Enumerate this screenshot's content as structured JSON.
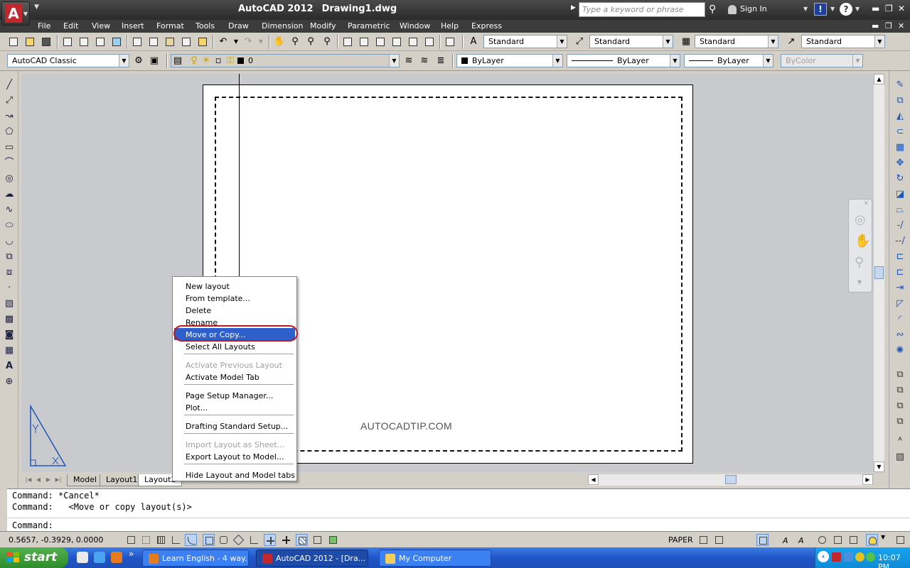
{
  "title": {
    "app": "AutoCAD 2012",
    "document": "Drawing1.dwg",
    "search_placeholder": "Type a keyword or phrase",
    "sign_in": "Sign In"
  },
  "menu": [
    "File",
    "Edit",
    "View",
    "Insert",
    "Format",
    "Tools",
    "Draw",
    "Dimension",
    "Modify",
    "Parametric",
    "Window",
    "Help",
    "Express"
  ],
  "styles": {
    "text_style": "Standard",
    "dim_style": "Standard",
    "table_style": "Standard",
    "multileader_style": "Standard"
  },
  "workspace": "AutoCAD Classic",
  "layer": "0",
  "properties": {
    "color": "ByLayer",
    "linetype": "ByLayer",
    "lineweight": "ByLayer",
    "plotstyle": "ByColor"
  },
  "watermark": "AUTOCADTIP.COM",
  "layout_tabs": [
    "Model",
    "Layout1",
    "Layout2"
  ],
  "context_menu": {
    "items": [
      {
        "label": "New layout",
        "disabled": false,
        "highlighted": false
      },
      {
        "label": "From template...",
        "disabled": false,
        "highlighted": false
      },
      {
        "label": "Delete",
        "disabled": false,
        "highlighted": false
      },
      {
        "label": "Rename",
        "disabled": false,
        "highlighted": false
      },
      {
        "label": "Move or Copy...",
        "disabled": false,
        "highlighted": true
      },
      {
        "label": "Select All Layouts",
        "disabled": false,
        "highlighted": false
      },
      {
        "label": "Activate Previous Layout",
        "disabled": true,
        "highlighted": false
      },
      {
        "label": "Activate Model Tab",
        "disabled": false,
        "highlighted": false
      },
      {
        "label": "Page Setup Manager...",
        "disabled": false,
        "highlighted": false
      },
      {
        "label": "Plot...",
        "disabled": false,
        "highlighted": false
      },
      {
        "label": "Drafting Standard Setup...",
        "disabled": false,
        "highlighted": false
      },
      {
        "label": "Import Layout as Sheet...",
        "disabled": true,
        "highlighted": false
      },
      {
        "label": "Export Layout to Model...",
        "disabled": false,
        "highlighted": false
      },
      {
        "label": "Hide Layout and Model tabs",
        "disabled": false,
        "highlighted": false
      }
    ]
  },
  "command_history": [
    "Command: *Cancel*",
    "Command:   <Move or copy layout(s)>"
  ],
  "command_prompt": "Command:",
  "status": {
    "coordinates": "0.5657, -0.3929, 0.0000",
    "space": "PAPER"
  },
  "taskbar": {
    "start": "start",
    "tasks": [
      "Learn English - 4 way...",
      "AutoCAD 2012 - [Dra...",
      "My Computer"
    ],
    "clock": "10:07 PM"
  },
  "colors": {
    "highlight": "#2f5fca",
    "annotation_ring": "#c0171d",
    "autocad_red": "#c1272d",
    "taskbar_blue": "#2155c8"
  }
}
